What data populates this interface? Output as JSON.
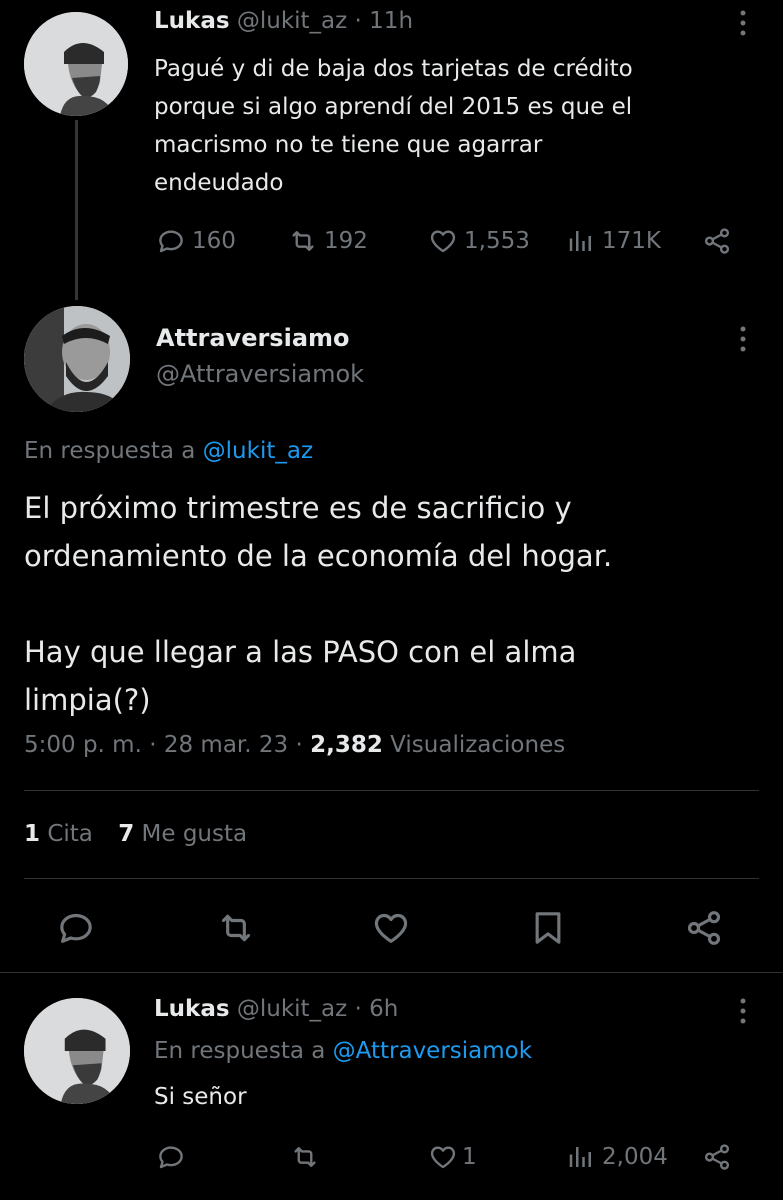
{
  "tweet1": {
    "name": "Lukas",
    "handle": "@lukit_az",
    "time": "11h",
    "text_lines": [
      "Pagué y di de baja dos tarjetas de crédito",
      "porque si algo aprendí del 2015 es que el",
      "macrismo no te tiene que agarrar",
      "endeudado"
    ],
    "replies": "160",
    "retweets": "192",
    "likes": "1,553",
    "views": "171K"
  },
  "tweet2": {
    "name": "Attraversiamo",
    "handle": "@Attraversiamok",
    "reply_prefix": "En respuesta a",
    "reply_to": "@lukit_az",
    "text_lines": [
      "El próximo trimestre es de sacrificio y",
      "ordenamiento de la economía del hogar.",
      "",
      "Hay que llegar a las PASO con el alma",
      "limpia(?)"
    ],
    "time": "5:00 p. m.",
    "date": "28 mar. 23",
    "views_count": "2,382",
    "views_label": "Visualizaciones",
    "quotes_count": "1",
    "quotes_label": "Cita",
    "likes_count": "7",
    "likes_label": "Me gusta"
  },
  "tweet3": {
    "name": "Lukas",
    "handle": "@lukit_az",
    "time": "6h",
    "reply_prefix": "En respuesta a",
    "reply_to": "@Attraversiamok",
    "text": "Si señor",
    "likes": "1",
    "views": "2,004"
  },
  "separator": "·",
  "icons": [
    "reply-icon",
    "retweet-icon",
    "like-icon",
    "views-icon",
    "share-icon",
    "bookmark-icon",
    "more-icon"
  ],
  "colors": {
    "background": "#000000",
    "text": "#e7e9ea",
    "muted": "#71767b",
    "link": "#1d9bf0"
  }
}
